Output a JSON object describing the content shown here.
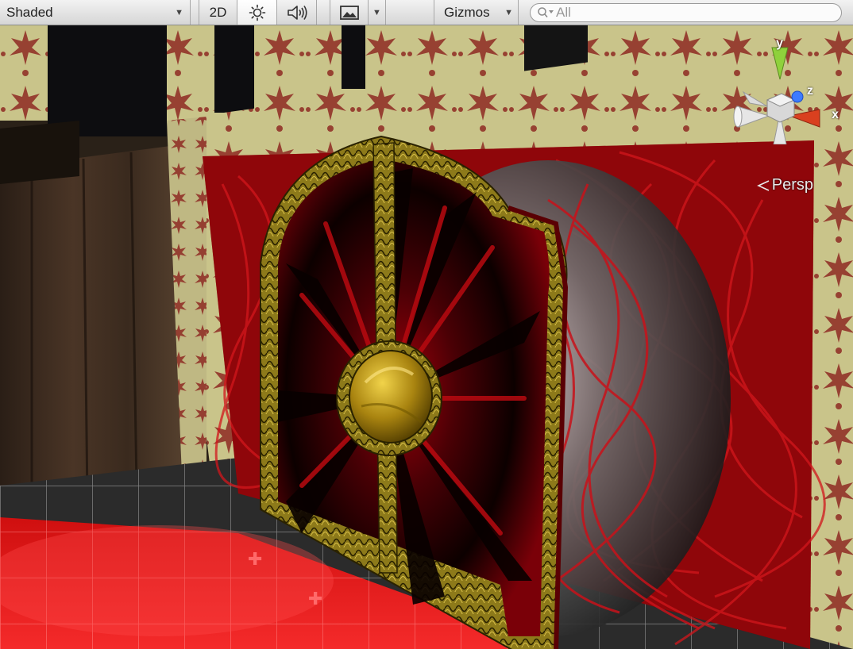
{
  "toolbar": {
    "draw_mode": "Shaded",
    "mode_2d": "2D",
    "gizmos_label": "Gizmos",
    "search_placeholder": "All",
    "icons": {
      "lighting": "sun-icon",
      "audio": "speaker-icon",
      "effects": "image-icon",
      "search": "search-icon"
    }
  },
  "scene_gizmo": {
    "axis_y": "y",
    "axis_z": "z",
    "axis_x": "x",
    "projection_label": "Persp",
    "colors": {
      "y": "#8fd13c",
      "z": "#3d7bff",
      "x": "#d9401f"
    }
  }
}
